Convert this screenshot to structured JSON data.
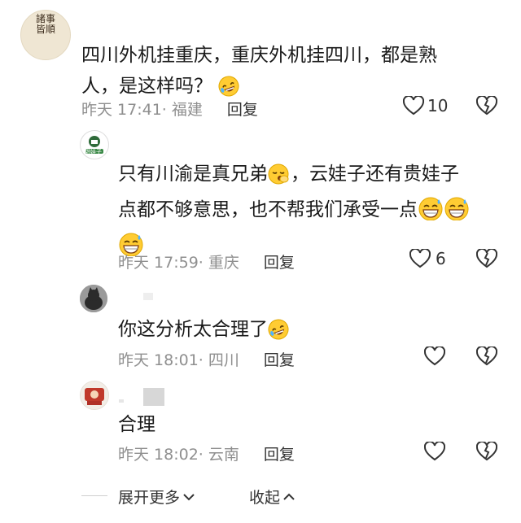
{
  "comments": [
    {
      "text_line1": "四川外机挂重庆，重庆外机挂四川，都是熟",
      "text_line2": "人，是这样吗？",
      "emoji": "rofl-emoji",
      "time": "昨天 17:41",
      "location": "· 福建",
      "reply": "回复",
      "likes": "10",
      "avatar_text": "諸事皆順"
    },
    {
      "text_line1": "只有川渝是真兄弟",
      "text_line1b": "，云娃子还有贵娃子",
      "text_line2": "点都不够意思，也不帮我们承受一点",
      "emoji1": "yawning-emoji",
      "emoji2": "grinning-sweat-emoji",
      "time": "昨天 17:59",
      "location": "· 重庆",
      "reply": "回复",
      "likes": "6",
      "avatar_text": "甜娃子"
    },
    {
      "text": "你这分析太合理了",
      "emoji": "rofl-emoji",
      "time": "昨天 18:01",
      "location": "· 四川",
      "reply": "回复"
    },
    {
      "text": "合理",
      "time": "昨天 18:02",
      "location": "· 云南",
      "reply": "回复"
    }
  ],
  "footer": {
    "expand": "展开更多",
    "collapse": "收起"
  },
  "colors": {
    "text": "#1a1a1a",
    "meta": "#8f8f8f",
    "icon": "#333333"
  }
}
